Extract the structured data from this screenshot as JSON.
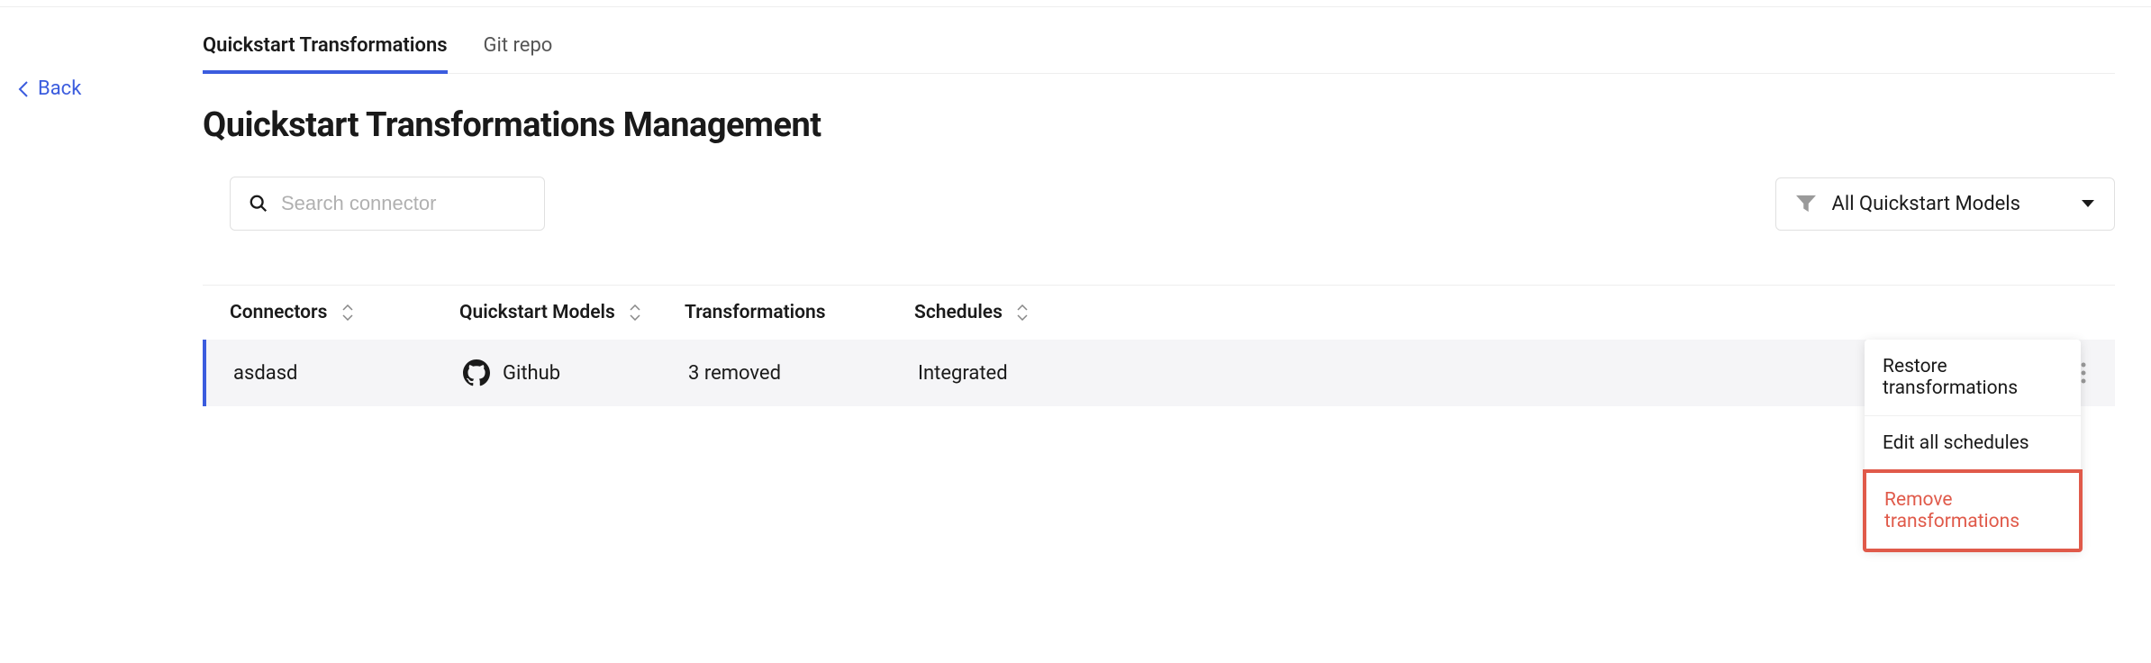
{
  "nav": {
    "back_label": "Back"
  },
  "tabs": {
    "active": "Quickstart Transformations",
    "inactive": "Git repo"
  },
  "page": {
    "title": "Quickstart Transformations Management"
  },
  "search": {
    "placeholder": "Search connector"
  },
  "filter": {
    "selected": "All Quickstart Models"
  },
  "table": {
    "headers": {
      "connectors": "Connectors",
      "models": "Quickstart Models",
      "transformations": "Transformations",
      "schedules": "Schedules"
    },
    "rows": [
      {
        "connector": "asdasd",
        "model_icon": "github-icon",
        "model": "Github",
        "transformations": "3 removed",
        "schedules": "Integrated"
      }
    ]
  },
  "menu": {
    "items": [
      {
        "label": "Restore transformations",
        "danger": false
      },
      {
        "label": "Edit all schedules",
        "danger": false
      },
      {
        "label": "Remove transformations",
        "danger": true
      }
    ]
  }
}
